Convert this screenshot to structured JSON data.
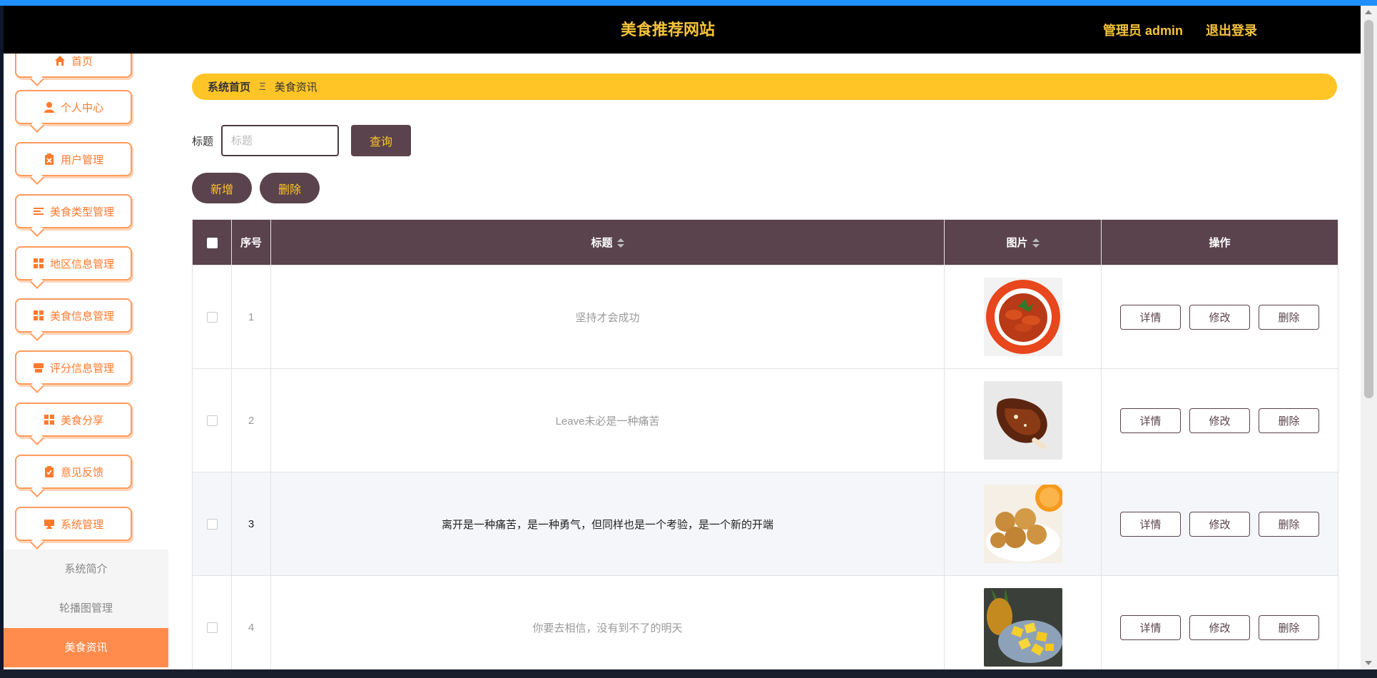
{
  "header": {
    "title": "美食推荐网站",
    "admin_label": "管理员 admin",
    "logout_label": "退出登录"
  },
  "sidebar": {
    "items": [
      {
        "label": "首页",
        "icon": "home-icon"
      },
      {
        "label": "个人中心",
        "icon": "user-icon"
      },
      {
        "label": "用户管理",
        "icon": "clipboard-x-icon"
      },
      {
        "label": "美食类型管理",
        "icon": "list-icon"
      },
      {
        "label": "地区信息管理",
        "icon": "grid-icon"
      },
      {
        "label": "美食信息管理",
        "icon": "grid-icon"
      },
      {
        "label": "评分信息管理",
        "icon": "store-icon"
      },
      {
        "label": "美食分享",
        "icon": "grid-icon"
      },
      {
        "label": "意见反馈",
        "icon": "clipboard-check-icon"
      },
      {
        "label": "系统管理",
        "icon": "monitor-icon"
      }
    ],
    "sub_items": [
      {
        "label": "系统简介",
        "active": false
      },
      {
        "label": "轮播图管理",
        "active": false
      },
      {
        "label": "美食资讯",
        "active": true
      }
    ]
  },
  "breadcrumb": {
    "home": "系统首页",
    "separator": "Ξ",
    "current": "美食资讯"
  },
  "search": {
    "label": "标题",
    "placeholder": "标题",
    "value": "",
    "query_button": "查询"
  },
  "actions": {
    "add_button": "新增",
    "delete_button": "删除"
  },
  "table": {
    "headers": {
      "index": "序号",
      "title": "标题",
      "image": "图片",
      "actions": "操作"
    },
    "row_actions": {
      "detail": "详情",
      "edit": "修改",
      "delete": "删除"
    },
    "rows": [
      {
        "index": "1",
        "title": "坚持才会成功",
        "image": "braised-shrimp",
        "highlighted": false
      },
      {
        "index": "2",
        "title": "Leave未必是一种痛苦",
        "image": "roast-chicken-leg",
        "highlighted": false
      },
      {
        "index": "3",
        "title": "离开是一种痛苦，是一种勇气，但同样也是一个考验，是一个新的开端",
        "image": "fried-balls-orange",
        "highlighted": true
      },
      {
        "index": "4",
        "title": "你要去相信，没有到不了的明天",
        "image": "pineapple",
        "highlighted": false
      }
    ]
  },
  "colors": {
    "header_bg": "#000000",
    "title_color": "#f5c33b",
    "accent_orange": "#ff8c4d",
    "breadcrumb_bg": "#ffc526",
    "primary_dark": "#5a434c"
  }
}
